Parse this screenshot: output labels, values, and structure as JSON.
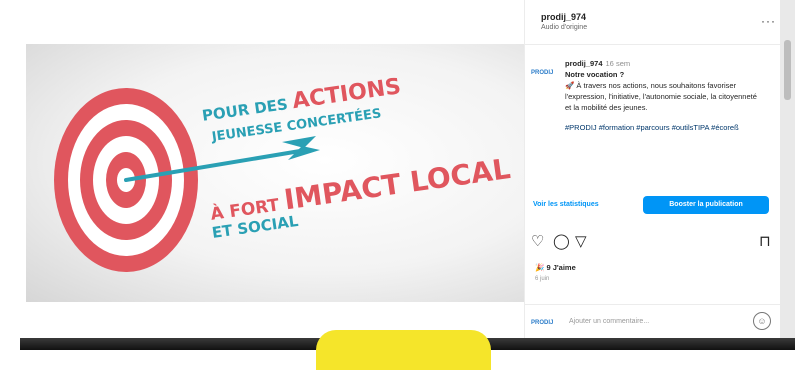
{
  "media": {
    "line1_small": "POUR DES ",
    "line1_big": "ACTIONS",
    "line2": "JEUNESSE CONCERTÉES",
    "line3_small": "À FORT ",
    "line3_big": "IMPACT LOCAL",
    "line4": "ET SOCIAL",
    "mute_icon": "speaker-muted-icon"
  },
  "header": {
    "username": "prodij_974",
    "audio": "Audio d'origine",
    "more_label": "···"
  },
  "caption": {
    "avatar_label": "PRODIJ",
    "username": "prodij_974",
    "time": "16 sem",
    "heading": "Notre vocation ?",
    "body": "🚀 À travers nos actions, nous souhaitons favoriser l'expression, l'initiative, l'autonomie sociale, la citoyenneté et la mobilité des jeunes.",
    "hashtags": "#PRODIJ #formation #parcours #outilsTIPA #écoreß"
  },
  "actions": {
    "stats_label": "Voir les statistiques",
    "boost_label": "Booster la publication",
    "like_icon": "heart-icon",
    "comment_icon": "comment-icon",
    "share_icon": "send-icon",
    "save_icon": "bookmark-icon"
  },
  "likes": {
    "prefix": "🎉",
    "text": "9 J'aime",
    "date": "6 juin"
  },
  "comment": {
    "avatar_label": "PRODIJ",
    "placeholder": "Ajouter un commentaire...",
    "emoji_icon": "smiley-icon"
  },
  "colors": {
    "accent": "#0095f6",
    "target_red": "#e0565e",
    "arrow_teal": "#2aa0b4",
    "highlight": "#f5e52a"
  }
}
